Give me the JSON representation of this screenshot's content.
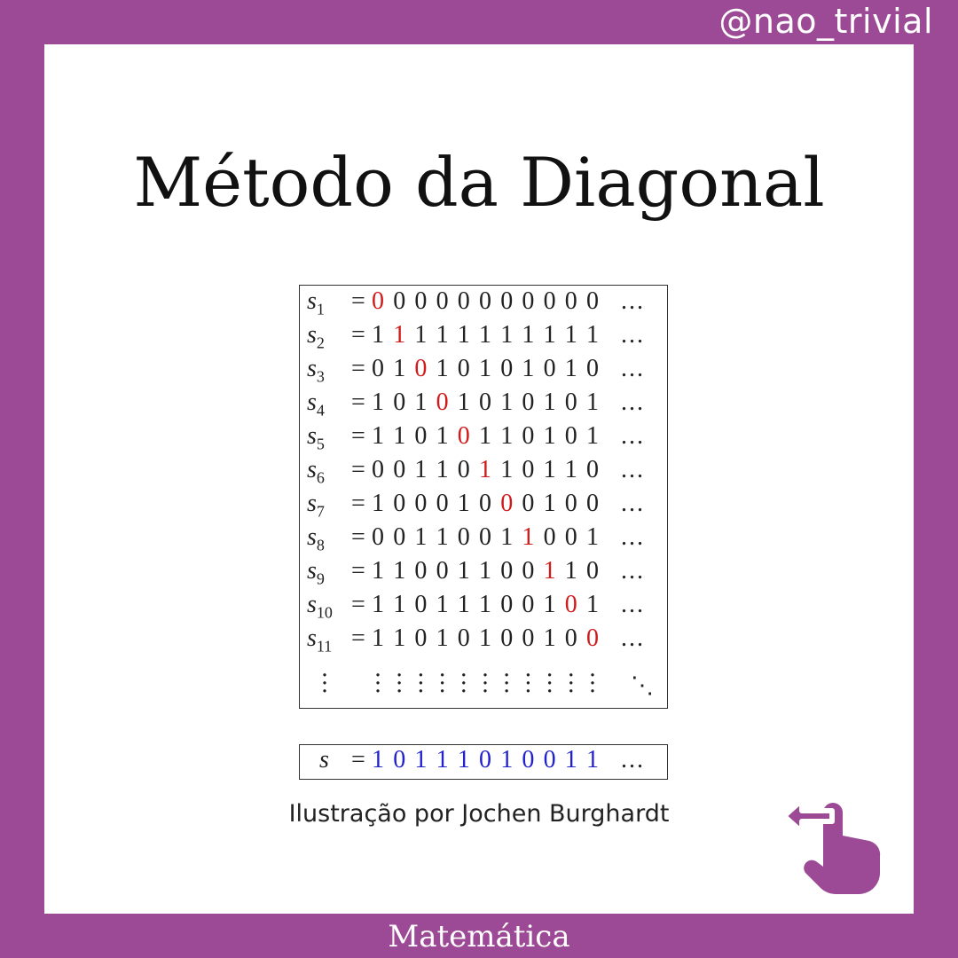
{
  "handle": "@nao_trivial",
  "title": "Método da Diagonal",
  "matrix": {
    "rows": [
      {
        "label": "s",
        "sub": "1",
        "digits": [
          "0",
          "0",
          "0",
          "0",
          "0",
          "0",
          "0",
          "0",
          "0",
          "0",
          "0"
        ],
        "highlight": 0
      },
      {
        "label": "s",
        "sub": "2",
        "digits": [
          "1",
          "1",
          "1",
          "1",
          "1",
          "1",
          "1",
          "1",
          "1",
          "1",
          "1"
        ],
        "highlight": 1
      },
      {
        "label": "s",
        "sub": "3",
        "digits": [
          "0",
          "1",
          "0",
          "1",
          "0",
          "1",
          "0",
          "1",
          "0",
          "1",
          "0"
        ],
        "highlight": 2
      },
      {
        "label": "s",
        "sub": "4",
        "digits": [
          "1",
          "0",
          "1",
          "0",
          "1",
          "0",
          "1",
          "0",
          "1",
          "0",
          "1"
        ],
        "highlight": 3
      },
      {
        "label": "s",
        "sub": "5",
        "digits": [
          "1",
          "1",
          "0",
          "1",
          "0",
          "1",
          "1",
          "0",
          "1",
          "0",
          "1"
        ],
        "highlight": 4
      },
      {
        "label": "s",
        "sub": "6",
        "digits": [
          "0",
          "0",
          "1",
          "1",
          "0",
          "1",
          "1",
          "0",
          "1",
          "1",
          "0"
        ],
        "highlight": 5
      },
      {
        "label": "s",
        "sub": "7",
        "digits": [
          "1",
          "0",
          "0",
          "0",
          "1",
          "0",
          "0",
          "0",
          "1",
          "0",
          "0"
        ],
        "highlight": 6
      },
      {
        "label": "s",
        "sub": "8",
        "digits": [
          "0",
          "0",
          "1",
          "1",
          "0",
          "0",
          "1",
          "1",
          "0",
          "0",
          "1"
        ],
        "highlight": 7
      },
      {
        "label": "s",
        "sub": "9",
        "digits": [
          "1",
          "1",
          "0",
          "0",
          "1",
          "1",
          "0",
          "0",
          "1",
          "1",
          "0"
        ],
        "highlight": 8
      },
      {
        "label": "s",
        "sub": "10",
        "digits": [
          "1",
          "1",
          "0",
          "1",
          "1",
          "1",
          "0",
          "0",
          "1",
          "0",
          "1"
        ],
        "highlight": 9
      },
      {
        "label": "s",
        "sub": "11",
        "digits": [
          "1",
          "1",
          "0",
          "1",
          "0",
          "1",
          "0",
          "0",
          "1",
          "0",
          "0"
        ],
        "highlight": 10
      }
    ],
    "equals": "=",
    "ellipsis": "...",
    "highlight_color": "#d11a1a"
  },
  "result": {
    "label": "s",
    "equals": "=",
    "digits": [
      "1",
      "0",
      "1",
      "1",
      "1",
      "0",
      "1",
      "0",
      "0",
      "1",
      "1"
    ],
    "ellipsis": "...",
    "color": "#2222cc"
  },
  "credit": "Ilustração por Jochen Burghardt",
  "footer": "Matemática",
  "swipe_icon": "swipe-left-hand-icon",
  "colors": {
    "frame": "#9c4a96",
    "card": "#ffffff"
  }
}
